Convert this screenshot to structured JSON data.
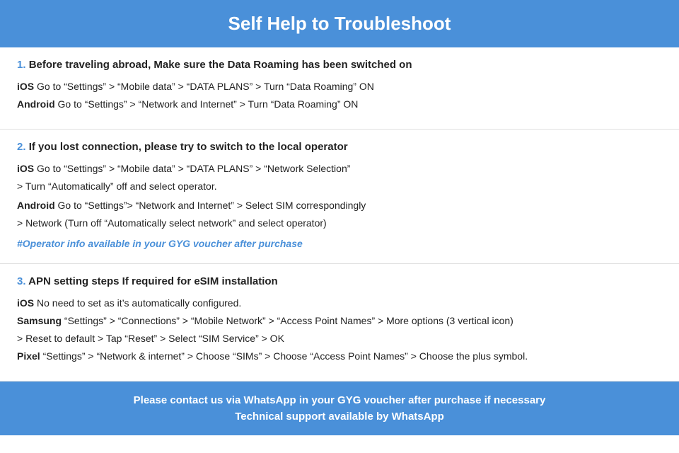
{
  "header": {
    "title": "Self Help to Troubleshoot"
  },
  "sections": [
    {
      "id": "section-1",
      "number": "1.",
      "title": "Before traveling abroad, Make sure the Data Roaming has been switched on",
      "steps": [
        {
          "label": "iOS",
          "text": "   Go to “Settings” > “Mobile data” > “DATA PLANS” > Turn “Data Roaming” ON"
        },
        {
          "label": "Android",
          "text": "    Go to “Settings” > “Network and Internet” > Turn “Data Roaming” ON"
        }
      ],
      "note": null
    },
    {
      "id": "section-2",
      "number": "2.",
      "title": "If you lost connection, please try to switch to the local operator",
      "steps": [
        {
          "label": "iOS",
          "text": "    Go to “Settings” > “Mobile data” > “DATA PLANS” > “Network Selection”"
        },
        {
          "label": "",
          "text": "> Turn “Automatically” off and select operator."
        },
        {
          "label": "Android",
          "text": "    Go to “Settings”>  “Network and Internet” > Select SIM correspondingly"
        },
        {
          "label": "",
          "text": "> Network (Turn off “Automatically select network” and select operator)"
        }
      ],
      "note": "#Operator info available in your GYG voucher after purchase"
    },
    {
      "id": "section-3",
      "number": "3.",
      "title": "APN setting steps If required for eSIM installation",
      "steps": [
        {
          "label": "iOS",
          "text": "    No need to set as it’s automatically configured."
        },
        {
          "label": "Samsung",
          "text": "    “Settings” > “Connections” > “Mobile Network” > “Access Point Names” > More options (3 vertical icon)"
        },
        {
          "label": "",
          "text": "> Reset to default > Tap “Reset” > Select “SIM Service” > OK"
        },
        {
          "label": "Pixel",
          "text": "    “Settings” > “Network & internet” > Choose “SIMs” > Choose “Access Point Names” > Choose the plus symbol."
        }
      ],
      "note": null
    }
  ],
  "footer": {
    "line1": "Please contact us via WhatsApp  in your GYG voucher after purchase if necessary",
    "line2": "Technical support available by WhatsApp"
  }
}
